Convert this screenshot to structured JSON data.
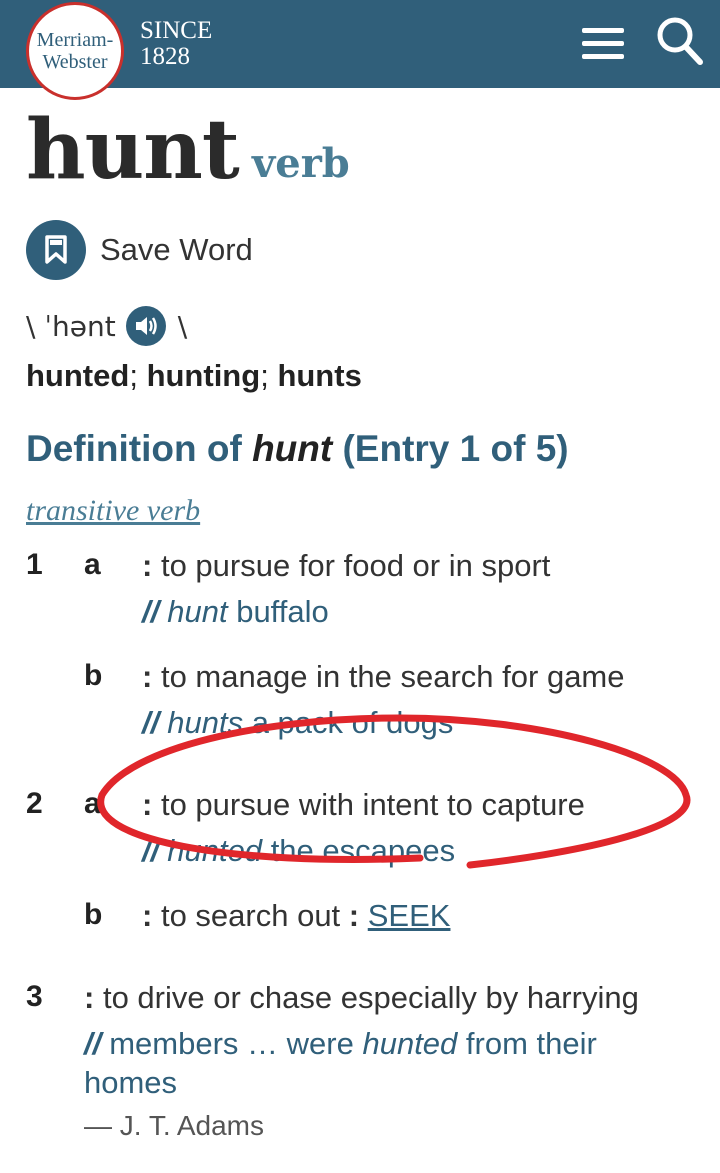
{
  "header": {
    "logo_line1": "Merriam-",
    "logo_line2": "Webster",
    "since_line1": "SINCE",
    "since_line2": "1828"
  },
  "entry": {
    "headword": "hunt",
    "part_of_speech": "verb",
    "save_label": "Save Word",
    "pron_open": "\\ ˈhənt",
    "pron_close": "\\",
    "forms": [
      "hunted",
      "hunting",
      "hunts"
    ],
    "forms_sep": ";",
    "heading_prefix": "Definition of",
    "heading_word": "hunt",
    "heading_entry": "(Entry 1 of 5)",
    "function_label": "transitive verb"
  },
  "senses": {
    "s1_num": "1",
    "s1a_letter": "a",
    "s1a_def": "to pursue for food or in sport",
    "s1a_ex_word": "hunt",
    "s1a_ex_rest": "buffalo",
    "s1b_letter": "b",
    "s1b_def": "to manage in the search for game",
    "s1b_ex_word": "hunts",
    "s1b_ex_rest": "a pack of dogs",
    "s2_num": "2",
    "s2a_letter": "a",
    "s2a_def": "to pursue with intent to capture",
    "s2a_ex_word": "hunted",
    "s2a_ex_rest": "the escapees",
    "s2b_letter": "b",
    "s2b_def": "to search out",
    "s2b_syn": "SEEK",
    "s3_num": "3",
    "s3_def": "to drive or chase especially by harrying",
    "s3_ex_pre": "members … were",
    "s3_ex_word": "hunted",
    "s3_ex_post": "from their",
    "s3_ex_line2": "homes",
    "s3_attribution": "— J. T. Adams"
  },
  "glyphs": {
    "colon": ":",
    "slashes": "//"
  },
  "colors": {
    "brand": "#305f7a",
    "accent": "#4a7d95",
    "logo_ring": "#c9302c",
    "annotation": "#e0262b"
  },
  "icons": [
    "menu-icon",
    "search-icon",
    "bookmark-icon",
    "speaker-icon"
  ]
}
